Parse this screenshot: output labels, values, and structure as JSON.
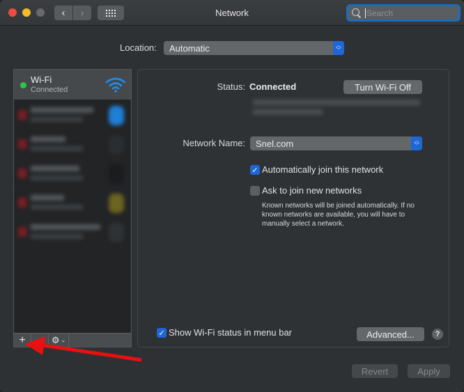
{
  "window": {
    "title": "Network",
    "search_placeholder": "Search"
  },
  "location": {
    "label": "Location:",
    "value": "Automatic"
  },
  "sidebar": {
    "services": [
      {
        "name": "Wi-Fi",
        "status": "Connected",
        "status_color": "#28c940",
        "icon": "wifi-icon",
        "selected": true
      }
    ],
    "blurred_items_count": 5,
    "toolbar": {
      "add_label": "+",
      "remove_label": "−",
      "action_label": "⚙",
      "action_chevron": "⌄"
    }
  },
  "detail": {
    "status_label": "Status:",
    "status_value": "Connected",
    "turn_off_label": "Turn Wi-Fi Off",
    "network_name_label": "Network Name:",
    "network_name_value": "Snel.com",
    "auto_join": {
      "label": "Automatically join this network",
      "checked": true
    },
    "ask_join": {
      "label": "Ask to join new networks",
      "checked": false
    },
    "ask_join_help": "Known networks will be joined automatically. If no known networks are available, you will have to manually select a network.",
    "show_menu": {
      "label": "Show Wi-Fi status in menu bar",
      "checked": true
    },
    "advanced_label": "Advanced...",
    "help_label": "?"
  },
  "footer": {
    "revert_label": "Revert",
    "apply_label": "Apply"
  },
  "colors": {
    "accent": "#1f66d6",
    "annotation_arrow": "#e81010"
  }
}
